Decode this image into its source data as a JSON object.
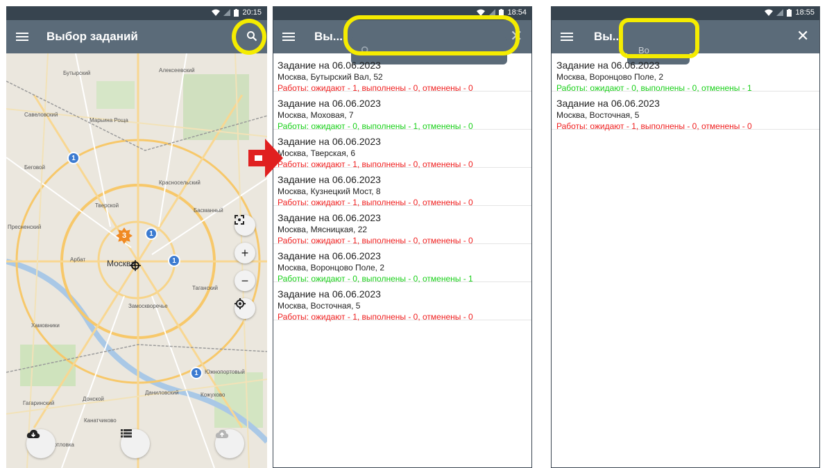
{
  "screen1": {
    "status_time": "20:15",
    "title": "Выбор заданий",
    "map_labels": {
      "butyrsky": "Бутырский",
      "alekseevsky": "Алексеевский",
      "savelovsky": "Савеловский",
      "maryina_roshcha": "Марьина Роща",
      "begovoy": "Беговой",
      "krasnoselsky": "Красносельский",
      "tverskoy": "Тверской",
      "basmanny": "Басманный",
      "presnensky": "Пресненский",
      "arbat": "Арбат",
      "moscow": "Москва",
      "taganskiy": "Таганский",
      "zamoskvorechye": "Замоскворечье",
      "khamovniki": "Хамовники",
      "yuzhnoportovy": "Южнопортовый",
      "donskoy": "Донской",
      "danilovsky": "Даниловский",
      "kozhukhovo": "Кожухово",
      "gagarinsky": "Гагаринский",
      "kotlovka": "Котловка",
      "kanatchikovo": "Канатчиково"
    },
    "markers": [
      "1",
      "1",
      "1",
      "1"
    ],
    "cluster": "3"
  },
  "screen2": {
    "status_time": "18:54",
    "title": "Вы...",
    "items": [
      {
        "title": "Задание на 06.06.2023",
        "address": "Москва, Бутырский Вал,  52",
        "status": "Работы: ожидают - 1, выполнены - 0, отменены - 0",
        "color": "red"
      },
      {
        "title": "Задание на 06.06.2023",
        "address": "Москва, Моховая,  7",
        "status": "Работы: ожидают - 0, выполнены - 1, отменены - 0",
        "color": "green"
      },
      {
        "title": "Задание на 06.06.2023",
        "address": "Москва, Тверская,  6",
        "status": "Работы: ожидают - 1, выполнены - 0, отменены - 0",
        "color": "red"
      },
      {
        "title": "Задание на 06.06.2023",
        "address": "Москва, Кузнецкий Мост,  8",
        "status": "Работы: ожидают - 1, выполнены - 0, отменены - 0",
        "color": "red"
      },
      {
        "title": "Задание на 06.06.2023",
        "address": "Москва, Мясницкая,  22",
        "status": "Работы: ожидают - 1, выполнены - 0, отменены - 0",
        "color": "red"
      },
      {
        "title": "Задание на 06.06.2023",
        "address": "Москва, Воронцово Поле,  2",
        "status": "Работы: ожидают - 0, выполнены - 0, отменены - 1",
        "color": "green"
      },
      {
        "title": "Задание на 06.06.2023",
        "address": "Москва, Восточная,  5",
        "status": "Работы: ожидают - 1, выполнены - 0, отменены - 0",
        "color": "red"
      }
    ]
  },
  "screen3": {
    "status_time": "18:55",
    "title": "Вы...",
    "search_value": "Во",
    "items": [
      {
        "title": "Задание на 06.06.2023",
        "address": "Москва, Воронцово Поле,  2",
        "status": "Работы: ожидают - 0, выполнены - 0, отменены - 1",
        "color": "green"
      },
      {
        "title": "Задание на 06.06.2023",
        "address": "Москва, Восточная,  5",
        "status": "Работы: ожидают - 1, выполнены - 0, отменены - 0",
        "color": "red"
      }
    ]
  },
  "colors": {
    "appbar": "#5b6b79",
    "statusbar": "#37444f",
    "highlight": "#f5ec00",
    "arrow": "#e02020",
    "status_red": "#f02020",
    "status_green": "#18d018",
    "marker": "#3c7bd1",
    "cluster": "#f08a24"
  },
  "icons": [
    "menu-icon",
    "search-icon",
    "close-icon",
    "wifi-icon",
    "signal-icon",
    "battery-icon",
    "fit-view-icon",
    "zoom-in-icon",
    "zoom-out-icon",
    "my-location-icon",
    "cloud-download-icon",
    "list-icon",
    "cloud-upload-icon",
    "arrow-right-icon"
  ]
}
